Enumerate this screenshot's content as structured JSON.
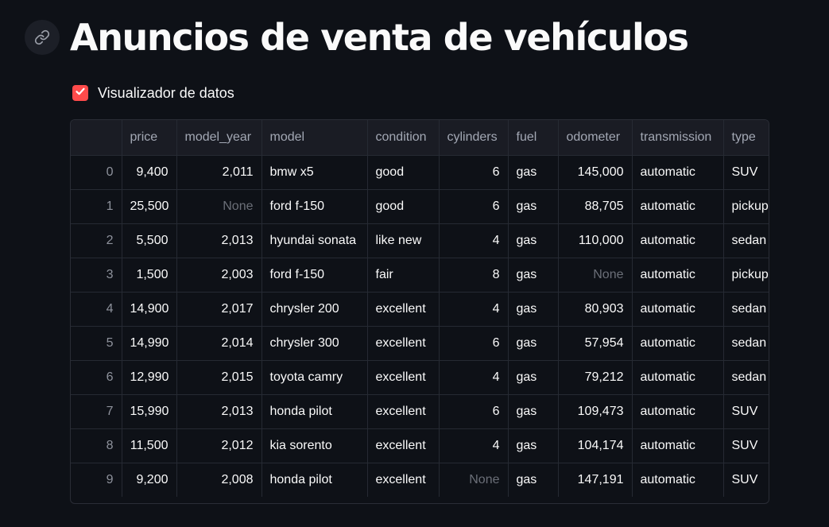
{
  "header": {
    "title": "Anuncios de venta de vehículos"
  },
  "checkbox": {
    "label": "Visualizador de datos",
    "checked": true,
    "color": "#ff4b4b"
  },
  "table": {
    "columns": [
      "",
      "price",
      "model_year",
      "model",
      "condition",
      "cylinders",
      "fuel",
      "odometer",
      "transmission",
      "type"
    ],
    "rows": [
      [
        "0",
        "9,400",
        "2,011",
        "bmw x5",
        "good",
        "6",
        "gas",
        "145,000",
        "automatic",
        "SUV"
      ],
      [
        "1",
        "25,500",
        "None",
        "ford f-150",
        "good",
        "6",
        "gas",
        "88,705",
        "automatic",
        "pickup"
      ],
      [
        "2",
        "5,500",
        "2,013",
        "hyundai sonata",
        "like new",
        "4",
        "gas",
        "110,000",
        "automatic",
        "sedan"
      ],
      [
        "3",
        "1,500",
        "2,003",
        "ford f-150",
        "fair",
        "8",
        "gas",
        "None",
        "automatic",
        "pickup"
      ],
      [
        "4",
        "14,900",
        "2,017",
        "chrysler 200",
        "excellent",
        "4",
        "gas",
        "80,903",
        "automatic",
        "sedan"
      ],
      [
        "5",
        "14,990",
        "2,014",
        "chrysler 300",
        "excellent",
        "6",
        "gas",
        "57,954",
        "automatic",
        "sedan"
      ],
      [
        "6",
        "12,990",
        "2,015",
        "toyota camry",
        "excellent",
        "4",
        "gas",
        "79,212",
        "automatic",
        "sedan"
      ],
      [
        "7",
        "15,990",
        "2,013",
        "honda pilot",
        "excellent",
        "6",
        "gas",
        "109,473",
        "automatic",
        "SUV"
      ],
      [
        "8",
        "11,500",
        "2,012",
        "kia sorento",
        "excellent",
        "4",
        "gas",
        "104,174",
        "automatic",
        "SUV"
      ],
      [
        "9",
        "9,200",
        "2,008",
        "honda pilot",
        "excellent",
        "None",
        "gas",
        "147,191",
        "automatic",
        "SUV"
      ]
    ]
  },
  "icons": {
    "anchor": "link-icon",
    "checkbox": "checkmark-icon"
  }
}
